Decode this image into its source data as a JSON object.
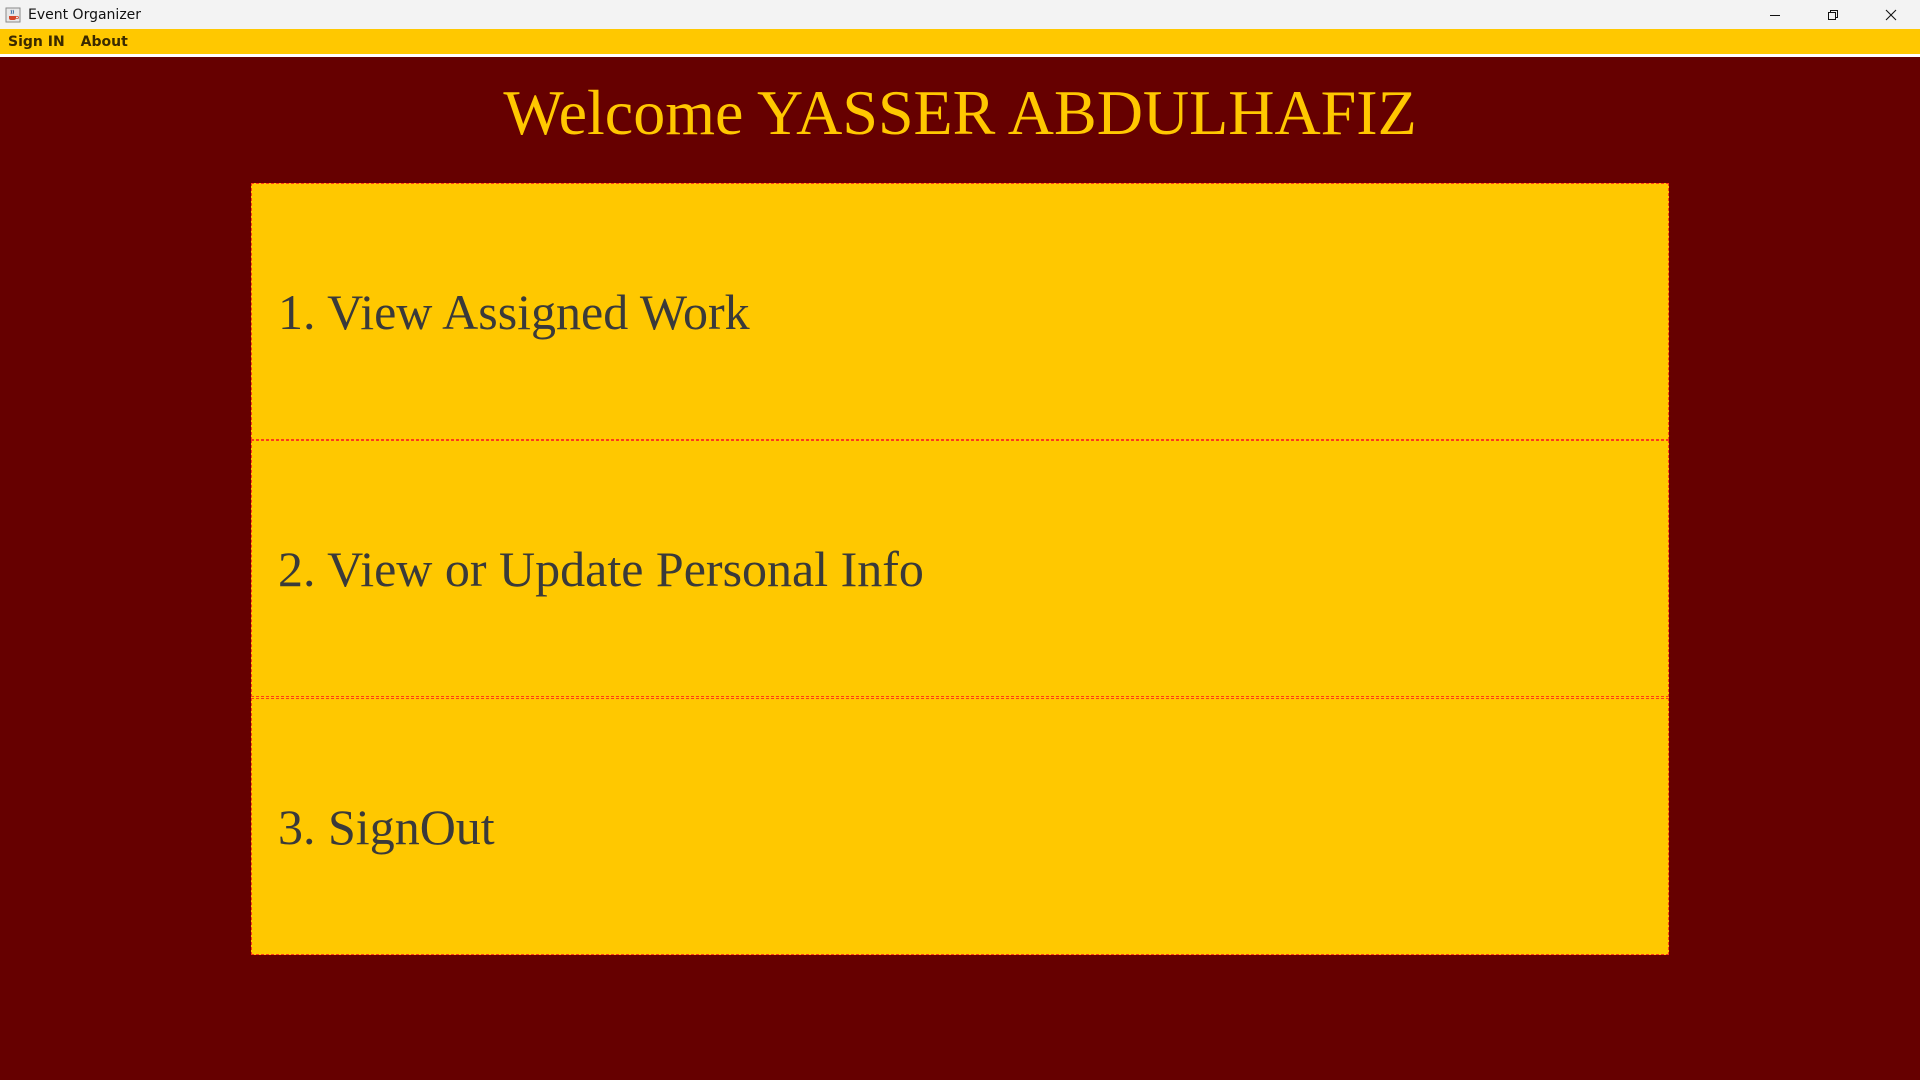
{
  "window": {
    "title": "Event Organizer",
    "icon": "java-cup-icon",
    "controls": [
      "minimize-icon",
      "restore-icon",
      "close-icon"
    ]
  },
  "menubar": {
    "items": [
      {
        "label": "Sign IN"
      },
      {
        "label": "About"
      }
    ]
  },
  "main": {
    "welcome": "Welcome YASSER ABDULHAFIZ",
    "options": [
      {
        "label": "1. View Assigned Work"
      },
      {
        "label": "2. View or Update Personal Info"
      },
      {
        "label": "3. SignOut"
      }
    ]
  },
  "colors": {
    "background": "#660000",
    "accent": "#ffc800",
    "option_text": "#3a3a3a",
    "option_border": "#ff3a1a"
  }
}
